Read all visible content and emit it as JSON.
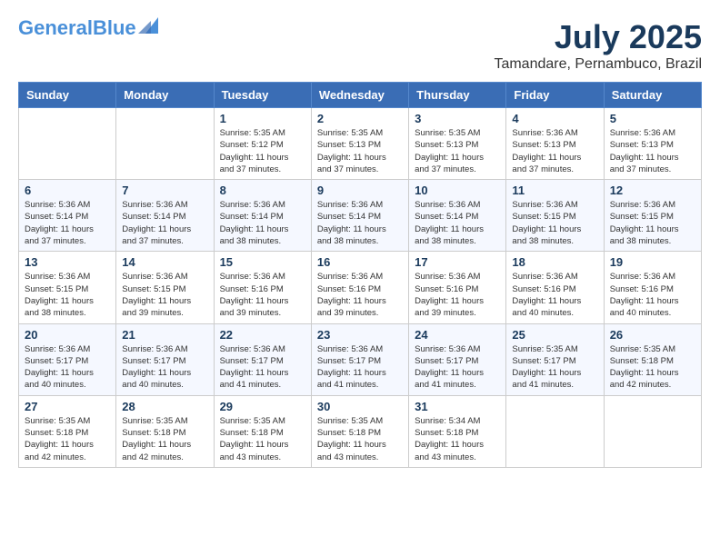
{
  "header": {
    "logo_general": "General",
    "logo_blue": "Blue",
    "month_title": "July 2025",
    "location": "Tamandare, Pernambuco, Brazil"
  },
  "calendar": {
    "headers": [
      "Sunday",
      "Monday",
      "Tuesday",
      "Wednesday",
      "Thursday",
      "Friday",
      "Saturday"
    ],
    "weeks": [
      [
        {
          "day": "",
          "info": ""
        },
        {
          "day": "",
          "info": ""
        },
        {
          "day": "1",
          "info": "Sunrise: 5:35 AM\nSunset: 5:12 PM\nDaylight: 11 hours and 37 minutes."
        },
        {
          "day": "2",
          "info": "Sunrise: 5:35 AM\nSunset: 5:13 PM\nDaylight: 11 hours and 37 minutes."
        },
        {
          "day": "3",
          "info": "Sunrise: 5:35 AM\nSunset: 5:13 PM\nDaylight: 11 hours and 37 minutes."
        },
        {
          "day": "4",
          "info": "Sunrise: 5:36 AM\nSunset: 5:13 PM\nDaylight: 11 hours and 37 minutes."
        },
        {
          "day": "5",
          "info": "Sunrise: 5:36 AM\nSunset: 5:13 PM\nDaylight: 11 hours and 37 minutes."
        }
      ],
      [
        {
          "day": "6",
          "info": "Sunrise: 5:36 AM\nSunset: 5:14 PM\nDaylight: 11 hours and 37 minutes."
        },
        {
          "day": "7",
          "info": "Sunrise: 5:36 AM\nSunset: 5:14 PM\nDaylight: 11 hours and 37 minutes."
        },
        {
          "day": "8",
          "info": "Sunrise: 5:36 AM\nSunset: 5:14 PM\nDaylight: 11 hours and 38 minutes."
        },
        {
          "day": "9",
          "info": "Sunrise: 5:36 AM\nSunset: 5:14 PM\nDaylight: 11 hours and 38 minutes."
        },
        {
          "day": "10",
          "info": "Sunrise: 5:36 AM\nSunset: 5:14 PM\nDaylight: 11 hours and 38 minutes."
        },
        {
          "day": "11",
          "info": "Sunrise: 5:36 AM\nSunset: 5:15 PM\nDaylight: 11 hours and 38 minutes."
        },
        {
          "day": "12",
          "info": "Sunrise: 5:36 AM\nSunset: 5:15 PM\nDaylight: 11 hours and 38 minutes."
        }
      ],
      [
        {
          "day": "13",
          "info": "Sunrise: 5:36 AM\nSunset: 5:15 PM\nDaylight: 11 hours and 38 minutes."
        },
        {
          "day": "14",
          "info": "Sunrise: 5:36 AM\nSunset: 5:15 PM\nDaylight: 11 hours and 39 minutes."
        },
        {
          "day": "15",
          "info": "Sunrise: 5:36 AM\nSunset: 5:16 PM\nDaylight: 11 hours and 39 minutes."
        },
        {
          "day": "16",
          "info": "Sunrise: 5:36 AM\nSunset: 5:16 PM\nDaylight: 11 hours and 39 minutes."
        },
        {
          "day": "17",
          "info": "Sunrise: 5:36 AM\nSunset: 5:16 PM\nDaylight: 11 hours and 39 minutes."
        },
        {
          "day": "18",
          "info": "Sunrise: 5:36 AM\nSunset: 5:16 PM\nDaylight: 11 hours and 40 minutes."
        },
        {
          "day": "19",
          "info": "Sunrise: 5:36 AM\nSunset: 5:16 PM\nDaylight: 11 hours and 40 minutes."
        }
      ],
      [
        {
          "day": "20",
          "info": "Sunrise: 5:36 AM\nSunset: 5:17 PM\nDaylight: 11 hours and 40 minutes."
        },
        {
          "day": "21",
          "info": "Sunrise: 5:36 AM\nSunset: 5:17 PM\nDaylight: 11 hours and 40 minutes."
        },
        {
          "day": "22",
          "info": "Sunrise: 5:36 AM\nSunset: 5:17 PM\nDaylight: 11 hours and 41 minutes."
        },
        {
          "day": "23",
          "info": "Sunrise: 5:36 AM\nSunset: 5:17 PM\nDaylight: 11 hours and 41 minutes."
        },
        {
          "day": "24",
          "info": "Sunrise: 5:36 AM\nSunset: 5:17 PM\nDaylight: 11 hours and 41 minutes."
        },
        {
          "day": "25",
          "info": "Sunrise: 5:35 AM\nSunset: 5:17 PM\nDaylight: 11 hours and 41 minutes."
        },
        {
          "day": "26",
          "info": "Sunrise: 5:35 AM\nSunset: 5:18 PM\nDaylight: 11 hours and 42 minutes."
        }
      ],
      [
        {
          "day": "27",
          "info": "Sunrise: 5:35 AM\nSunset: 5:18 PM\nDaylight: 11 hours and 42 minutes."
        },
        {
          "day": "28",
          "info": "Sunrise: 5:35 AM\nSunset: 5:18 PM\nDaylight: 11 hours and 42 minutes."
        },
        {
          "day": "29",
          "info": "Sunrise: 5:35 AM\nSunset: 5:18 PM\nDaylight: 11 hours and 43 minutes."
        },
        {
          "day": "30",
          "info": "Sunrise: 5:35 AM\nSunset: 5:18 PM\nDaylight: 11 hours and 43 minutes."
        },
        {
          "day": "31",
          "info": "Sunrise: 5:34 AM\nSunset: 5:18 PM\nDaylight: 11 hours and 43 minutes."
        },
        {
          "day": "",
          "info": ""
        },
        {
          "day": "",
          "info": ""
        }
      ]
    ]
  }
}
